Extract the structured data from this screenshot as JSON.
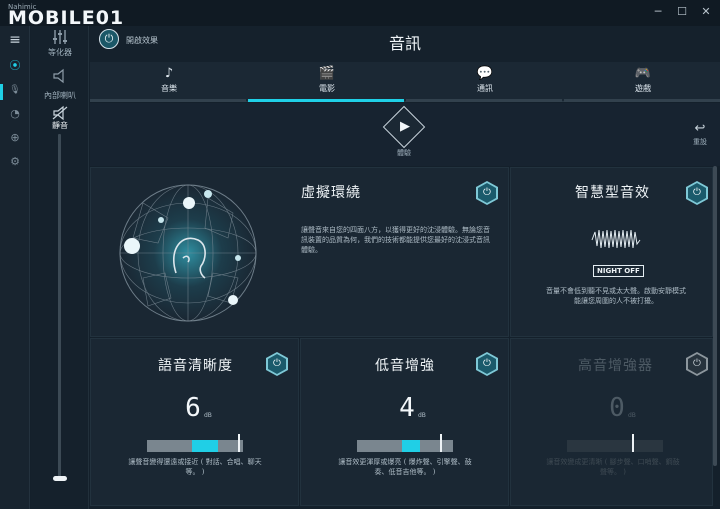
{
  "window": {
    "app_name": "Nahimic",
    "logo_text": "MOBILE01",
    "minimize": "─",
    "maximize": "☐",
    "close": "✕"
  },
  "rail": {
    "menu": "≡",
    "audio": "⦿",
    "mic": "🎙",
    "gauge": "◔",
    "network": "⊕",
    "settings": "⚙"
  },
  "side": {
    "equalizer": "等化器",
    "speaker": "內部喇叭",
    "mute": "靜音"
  },
  "volume": {
    "level": 0.0
  },
  "header": {
    "title": "音訊",
    "effects_label": "開啟效果",
    "power": "⏻"
  },
  "tabs": [
    {
      "icon": "♪",
      "label": "音樂"
    },
    {
      "icon": "🎬",
      "label": "電影"
    },
    {
      "icon": "💬",
      "label": "通訊"
    },
    {
      "icon": "🎮",
      "label": "遊戲"
    }
  ],
  "active_tab": 1,
  "test": {
    "play": "▶",
    "label": "體驗"
  },
  "reset": {
    "icon": "↩",
    "label": "重設"
  },
  "surround": {
    "title": "虛擬環繞",
    "power": "⏻",
    "description": "讓聲音來自您的四面八方，以獲得更好的沈浸體驗。無論您音訊裝置的品質為何，我們的技術都能提供您最好的沈浸式音訊體驗。"
  },
  "smart": {
    "title": "智慧型音效",
    "power": "⏻",
    "badge": "NIGHT OFF",
    "description": "音量不會低到聽不見或太大聲。啟動安靜模式能讓您周圍的人不被打擾。"
  },
  "voice": {
    "title": "語音清晰度",
    "power": "⏻",
    "value": "6",
    "unit": "dB",
    "level": 0.47,
    "fill_end": 0.74,
    "description": "讓聲音變得還遠或接近 ( 對話、合唱、聊天等。 )"
  },
  "bass": {
    "title": "低音增強",
    "power": "⏻",
    "value": "4",
    "unit": "dB",
    "level": 0.47,
    "fill_end": 0.66,
    "description": "讓音效更渾厚或爆亮 ( 爆炸聲、引擎聲、鼓奏、低音吉他等。 )"
  },
  "treble": {
    "title": "高音增強器",
    "power": "⏻",
    "value": "0",
    "unit": "dB",
    "level": 0.47,
    "fill_end": 0.47,
    "description": "讓音效變成更清晰 ( 腳步聲、口哨聲、鋼鼓聲等。 )"
  },
  "colors": {
    "accent": "#1fd0e6",
    "background": "#14202b",
    "panel": "#1a2733"
  }
}
